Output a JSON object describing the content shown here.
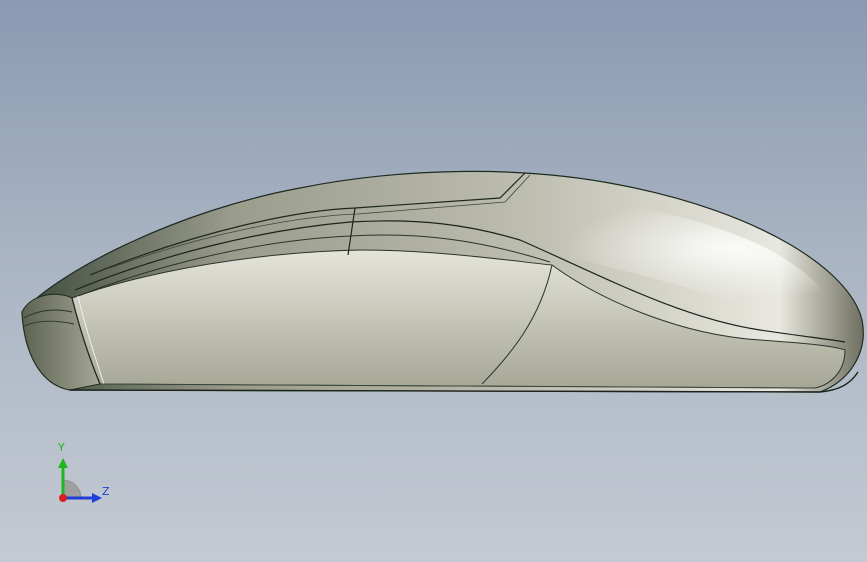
{
  "viewport": {
    "background_top": "#8a9ab2",
    "background_bottom": "#c4cad3",
    "model_name_icon": "computer-mouse-model"
  },
  "triad": {
    "y_label": "Y",
    "z_label": "Z",
    "y_color": "#1fb51f",
    "z_color": "#1f3fd8",
    "origin_color": "#d81f1f"
  }
}
